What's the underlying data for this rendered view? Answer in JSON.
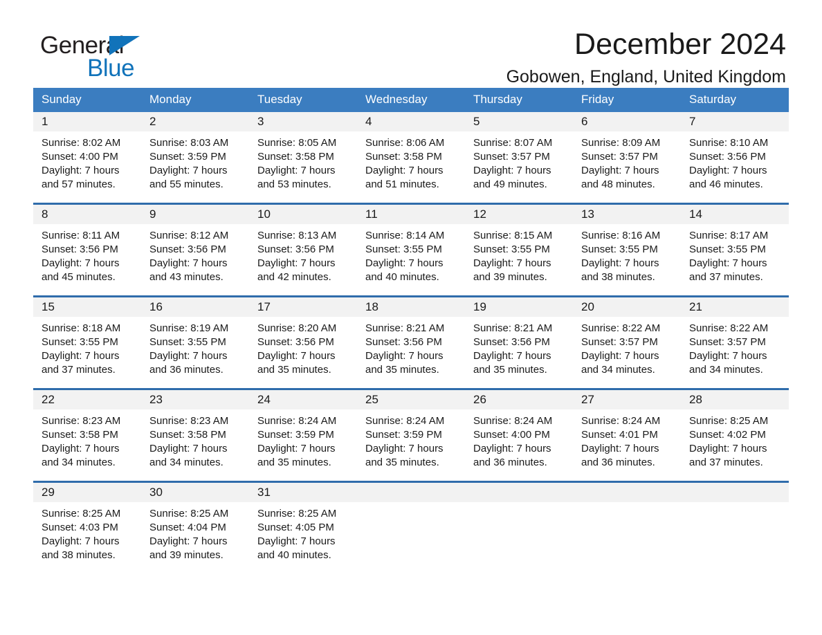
{
  "logo": {
    "word1": "General",
    "word2": "Blue",
    "triangle_color": "#1173ba"
  },
  "header": {
    "title": "December 2024",
    "subtitle": "Gobowen, England, United Kingdom"
  },
  "colors": {
    "header_blue": "#3b7dc0",
    "row_divider_blue": "#2f6cab",
    "daynum_band": "#f2f2f2"
  },
  "weekday_headers": [
    "Sunday",
    "Monday",
    "Tuesday",
    "Wednesday",
    "Thursday",
    "Friday",
    "Saturday"
  ],
  "weeks": [
    [
      {
        "day": "1",
        "sunrise": "Sunrise: 8:02 AM",
        "sunset": "Sunset: 4:00 PM",
        "daylight1": "Daylight: 7 hours",
        "daylight2": "and 57 minutes."
      },
      {
        "day": "2",
        "sunrise": "Sunrise: 8:03 AM",
        "sunset": "Sunset: 3:59 PM",
        "daylight1": "Daylight: 7 hours",
        "daylight2": "and 55 minutes."
      },
      {
        "day": "3",
        "sunrise": "Sunrise: 8:05 AM",
        "sunset": "Sunset: 3:58 PM",
        "daylight1": "Daylight: 7 hours",
        "daylight2": "and 53 minutes."
      },
      {
        "day": "4",
        "sunrise": "Sunrise: 8:06 AM",
        "sunset": "Sunset: 3:58 PM",
        "daylight1": "Daylight: 7 hours",
        "daylight2": "and 51 minutes."
      },
      {
        "day": "5",
        "sunrise": "Sunrise: 8:07 AM",
        "sunset": "Sunset: 3:57 PM",
        "daylight1": "Daylight: 7 hours",
        "daylight2": "and 49 minutes."
      },
      {
        "day": "6",
        "sunrise": "Sunrise: 8:09 AM",
        "sunset": "Sunset: 3:57 PM",
        "daylight1": "Daylight: 7 hours",
        "daylight2": "and 48 minutes."
      },
      {
        "day": "7",
        "sunrise": "Sunrise: 8:10 AM",
        "sunset": "Sunset: 3:56 PM",
        "daylight1": "Daylight: 7 hours",
        "daylight2": "and 46 minutes."
      }
    ],
    [
      {
        "day": "8",
        "sunrise": "Sunrise: 8:11 AM",
        "sunset": "Sunset: 3:56 PM",
        "daylight1": "Daylight: 7 hours",
        "daylight2": "and 45 minutes."
      },
      {
        "day": "9",
        "sunrise": "Sunrise: 8:12 AM",
        "sunset": "Sunset: 3:56 PM",
        "daylight1": "Daylight: 7 hours",
        "daylight2": "and 43 minutes."
      },
      {
        "day": "10",
        "sunrise": "Sunrise: 8:13 AM",
        "sunset": "Sunset: 3:56 PM",
        "daylight1": "Daylight: 7 hours",
        "daylight2": "and 42 minutes."
      },
      {
        "day": "11",
        "sunrise": "Sunrise: 8:14 AM",
        "sunset": "Sunset: 3:55 PM",
        "daylight1": "Daylight: 7 hours",
        "daylight2": "and 40 minutes."
      },
      {
        "day": "12",
        "sunrise": "Sunrise: 8:15 AM",
        "sunset": "Sunset: 3:55 PM",
        "daylight1": "Daylight: 7 hours",
        "daylight2": "and 39 minutes."
      },
      {
        "day": "13",
        "sunrise": "Sunrise: 8:16 AM",
        "sunset": "Sunset: 3:55 PM",
        "daylight1": "Daylight: 7 hours",
        "daylight2": "and 38 minutes."
      },
      {
        "day": "14",
        "sunrise": "Sunrise: 8:17 AM",
        "sunset": "Sunset: 3:55 PM",
        "daylight1": "Daylight: 7 hours",
        "daylight2": "and 37 minutes."
      }
    ],
    [
      {
        "day": "15",
        "sunrise": "Sunrise: 8:18 AM",
        "sunset": "Sunset: 3:55 PM",
        "daylight1": "Daylight: 7 hours",
        "daylight2": "and 37 minutes."
      },
      {
        "day": "16",
        "sunrise": "Sunrise: 8:19 AM",
        "sunset": "Sunset: 3:55 PM",
        "daylight1": "Daylight: 7 hours",
        "daylight2": "and 36 minutes."
      },
      {
        "day": "17",
        "sunrise": "Sunrise: 8:20 AM",
        "sunset": "Sunset: 3:56 PM",
        "daylight1": "Daylight: 7 hours",
        "daylight2": "and 35 minutes."
      },
      {
        "day": "18",
        "sunrise": "Sunrise: 8:21 AM",
        "sunset": "Sunset: 3:56 PM",
        "daylight1": "Daylight: 7 hours",
        "daylight2": "and 35 minutes."
      },
      {
        "day": "19",
        "sunrise": "Sunrise: 8:21 AM",
        "sunset": "Sunset: 3:56 PM",
        "daylight1": "Daylight: 7 hours",
        "daylight2": "and 35 minutes."
      },
      {
        "day": "20",
        "sunrise": "Sunrise: 8:22 AM",
        "sunset": "Sunset: 3:57 PM",
        "daylight1": "Daylight: 7 hours",
        "daylight2": "and 34 minutes."
      },
      {
        "day": "21",
        "sunrise": "Sunrise: 8:22 AM",
        "sunset": "Sunset: 3:57 PM",
        "daylight1": "Daylight: 7 hours",
        "daylight2": "and 34 minutes."
      }
    ],
    [
      {
        "day": "22",
        "sunrise": "Sunrise: 8:23 AM",
        "sunset": "Sunset: 3:58 PM",
        "daylight1": "Daylight: 7 hours",
        "daylight2": "and 34 minutes."
      },
      {
        "day": "23",
        "sunrise": "Sunrise: 8:23 AM",
        "sunset": "Sunset: 3:58 PM",
        "daylight1": "Daylight: 7 hours",
        "daylight2": "and 34 minutes."
      },
      {
        "day": "24",
        "sunrise": "Sunrise: 8:24 AM",
        "sunset": "Sunset: 3:59 PM",
        "daylight1": "Daylight: 7 hours",
        "daylight2": "and 35 minutes."
      },
      {
        "day": "25",
        "sunrise": "Sunrise: 8:24 AM",
        "sunset": "Sunset: 3:59 PM",
        "daylight1": "Daylight: 7 hours",
        "daylight2": "and 35 minutes."
      },
      {
        "day": "26",
        "sunrise": "Sunrise: 8:24 AM",
        "sunset": "Sunset: 4:00 PM",
        "daylight1": "Daylight: 7 hours",
        "daylight2": "and 36 minutes."
      },
      {
        "day": "27",
        "sunrise": "Sunrise: 8:24 AM",
        "sunset": "Sunset: 4:01 PM",
        "daylight1": "Daylight: 7 hours",
        "daylight2": "and 36 minutes."
      },
      {
        "day": "28",
        "sunrise": "Sunrise: 8:25 AM",
        "sunset": "Sunset: 4:02 PM",
        "daylight1": "Daylight: 7 hours",
        "daylight2": "and 37 minutes."
      }
    ],
    [
      {
        "day": "29",
        "sunrise": "Sunrise: 8:25 AM",
        "sunset": "Sunset: 4:03 PM",
        "daylight1": "Daylight: 7 hours",
        "daylight2": "and 38 minutes."
      },
      {
        "day": "30",
        "sunrise": "Sunrise: 8:25 AM",
        "sunset": "Sunset: 4:04 PM",
        "daylight1": "Daylight: 7 hours",
        "daylight2": "and 39 minutes."
      },
      {
        "day": "31",
        "sunrise": "Sunrise: 8:25 AM",
        "sunset": "Sunset: 4:05 PM",
        "daylight1": "Daylight: 7 hours",
        "daylight2": "and 40 minutes."
      },
      {
        "day": "",
        "sunrise": "",
        "sunset": "",
        "daylight1": "",
        "daylight2": ""
      },
      {
        "day": "",
        "sunrise": "",
        "sunset": "",
        "daylight1": "",
        "daylight2": ""
      },
      {
        "day": "",
        "sunrise": "",
        "sunset": "",
        "daylight1": "",
        "daylight2": ""
      },
      {
        "day": "",
        "sunrise": "",
        "sunset": "",
        "daylight1": "",
        "daylight2": ""
      }
    ]
  ]
}
